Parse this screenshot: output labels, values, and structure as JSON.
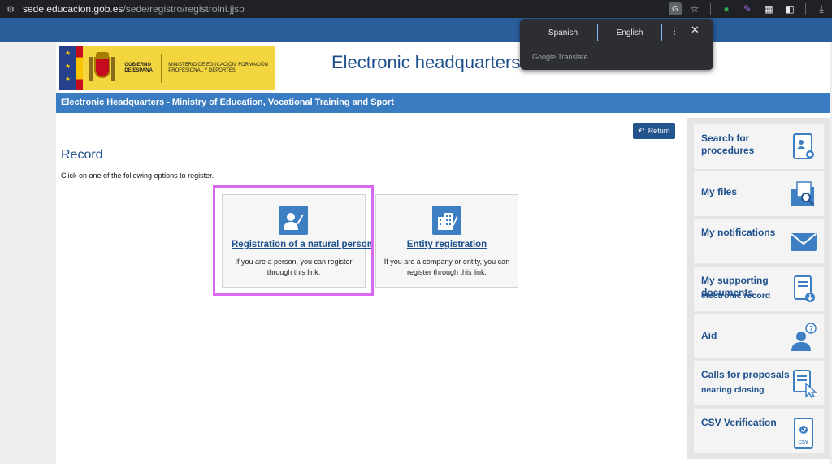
{
  "browser": {
    "url_host": "sede.educacion.gob.es",
    "url_path": "/sede/registro/registrolni.jjsp"
  },
  "translate_popup": {
    "lang_source": "Spanish",
    "lang_target": "English",
    "brand": "Google Translate"
  },
  "header": {
    "gov_text": "GOBIERNO DE ESPAÑA",
    "ministry_text": "MINISTERIO DE EDUCACIÓN, FORMACIÓN PROFESIONAL Y DEPORTES",
    "site_title": "Electronic headquarters",
    "title_bar": "Electronic Headquarters - Ministry of Education, Vocational Training and Sport"
  },
  "main": {
    "return_label": "Return",
    "title": "Record",
    "description": "Click on one of the following options to register.",
    "options": [
      {
        "label": "Registration of a natural person",
        "description": "If you are a person, you can register through this link."
      },
      {
        "label": "Entity registration",
        "description": "If you are a company or entity, you can register through this link."
      }
    ]
  },
  "sidebar": {
    "items": [
      {
        "label": "Search for procedures"
      },
      {
        "label": "My files"
      },
      {
        "label": "My notifications"
      },
      {
        "label": "My supporting documents",
        "overlap": "electronic record"
      },
      {
        "label": "Aid"
      },
      {
        "label": "Calls for proposals",
        "sub": "nearing closing"
      },
      {
        "label": "CSV Verification"
      }
    ]
  },
  "colors": {
    "brand_blue": "#1c4f8c",
    "bar_blue": "#3a7cc2",
    "highlight": "#d868f0"
  }
}
